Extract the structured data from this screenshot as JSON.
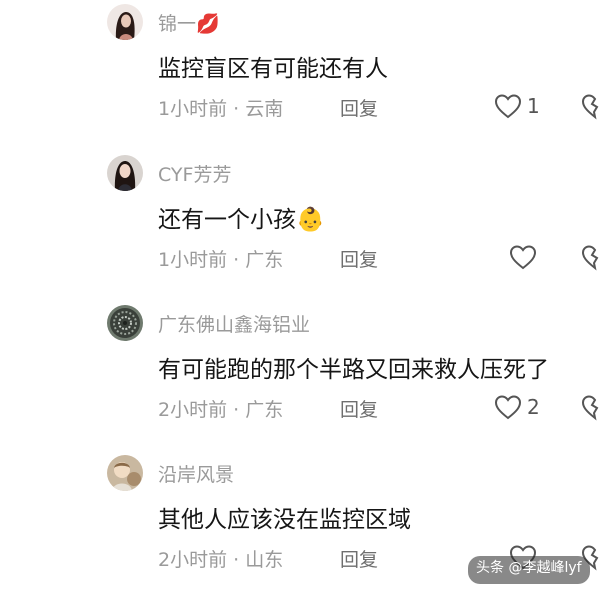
{
  "comments": [
    {
      "username": "锦一💋",
      "text": "监控盲区有可能还有人",
      "time": "1小时前",
      "location": "云南",
      "reply_label": "回复",
      "like_count": "1",
      "avatar_icon": "avatar-woman-dark-hair"
    },
    {
      "username": "CYF芳芳",
      "text": "还有一个小孩👶",
      "time": "1小时前",
      "location": "广东",
      "reply_label": "回复",
      "like_count": "",
      "avatar_icon": "avatar-woman-portrait"
    },
    {
      "username": "广东佛山鑫海铝业",
      "text": "有可能跑的那个半路又回来救人压死了",
      "time": "2小时前",
      "location": "广东",
      "reply_label": "回复",
      "like_count": "2",
      "avatar_icon": "avatar-metal-coil"
    },
    {
      "username": "沿岸风景",
      "text": "其他人应该没在监控区域",
      "time": "2小时前",
      "location": "山东",
      "reply_label": "回复",
      "like_count": "",
      "avatar_icon": "avatar-child-photo"
    }
  ],
  "separator": " · ",
  "watermark": "头条 @李越峰lyf",
  "colors": {
    "meta_text": "#9a9a9a",
    "body_text": "#161616",
    "icon_stroke": "#555555"
  }
}
